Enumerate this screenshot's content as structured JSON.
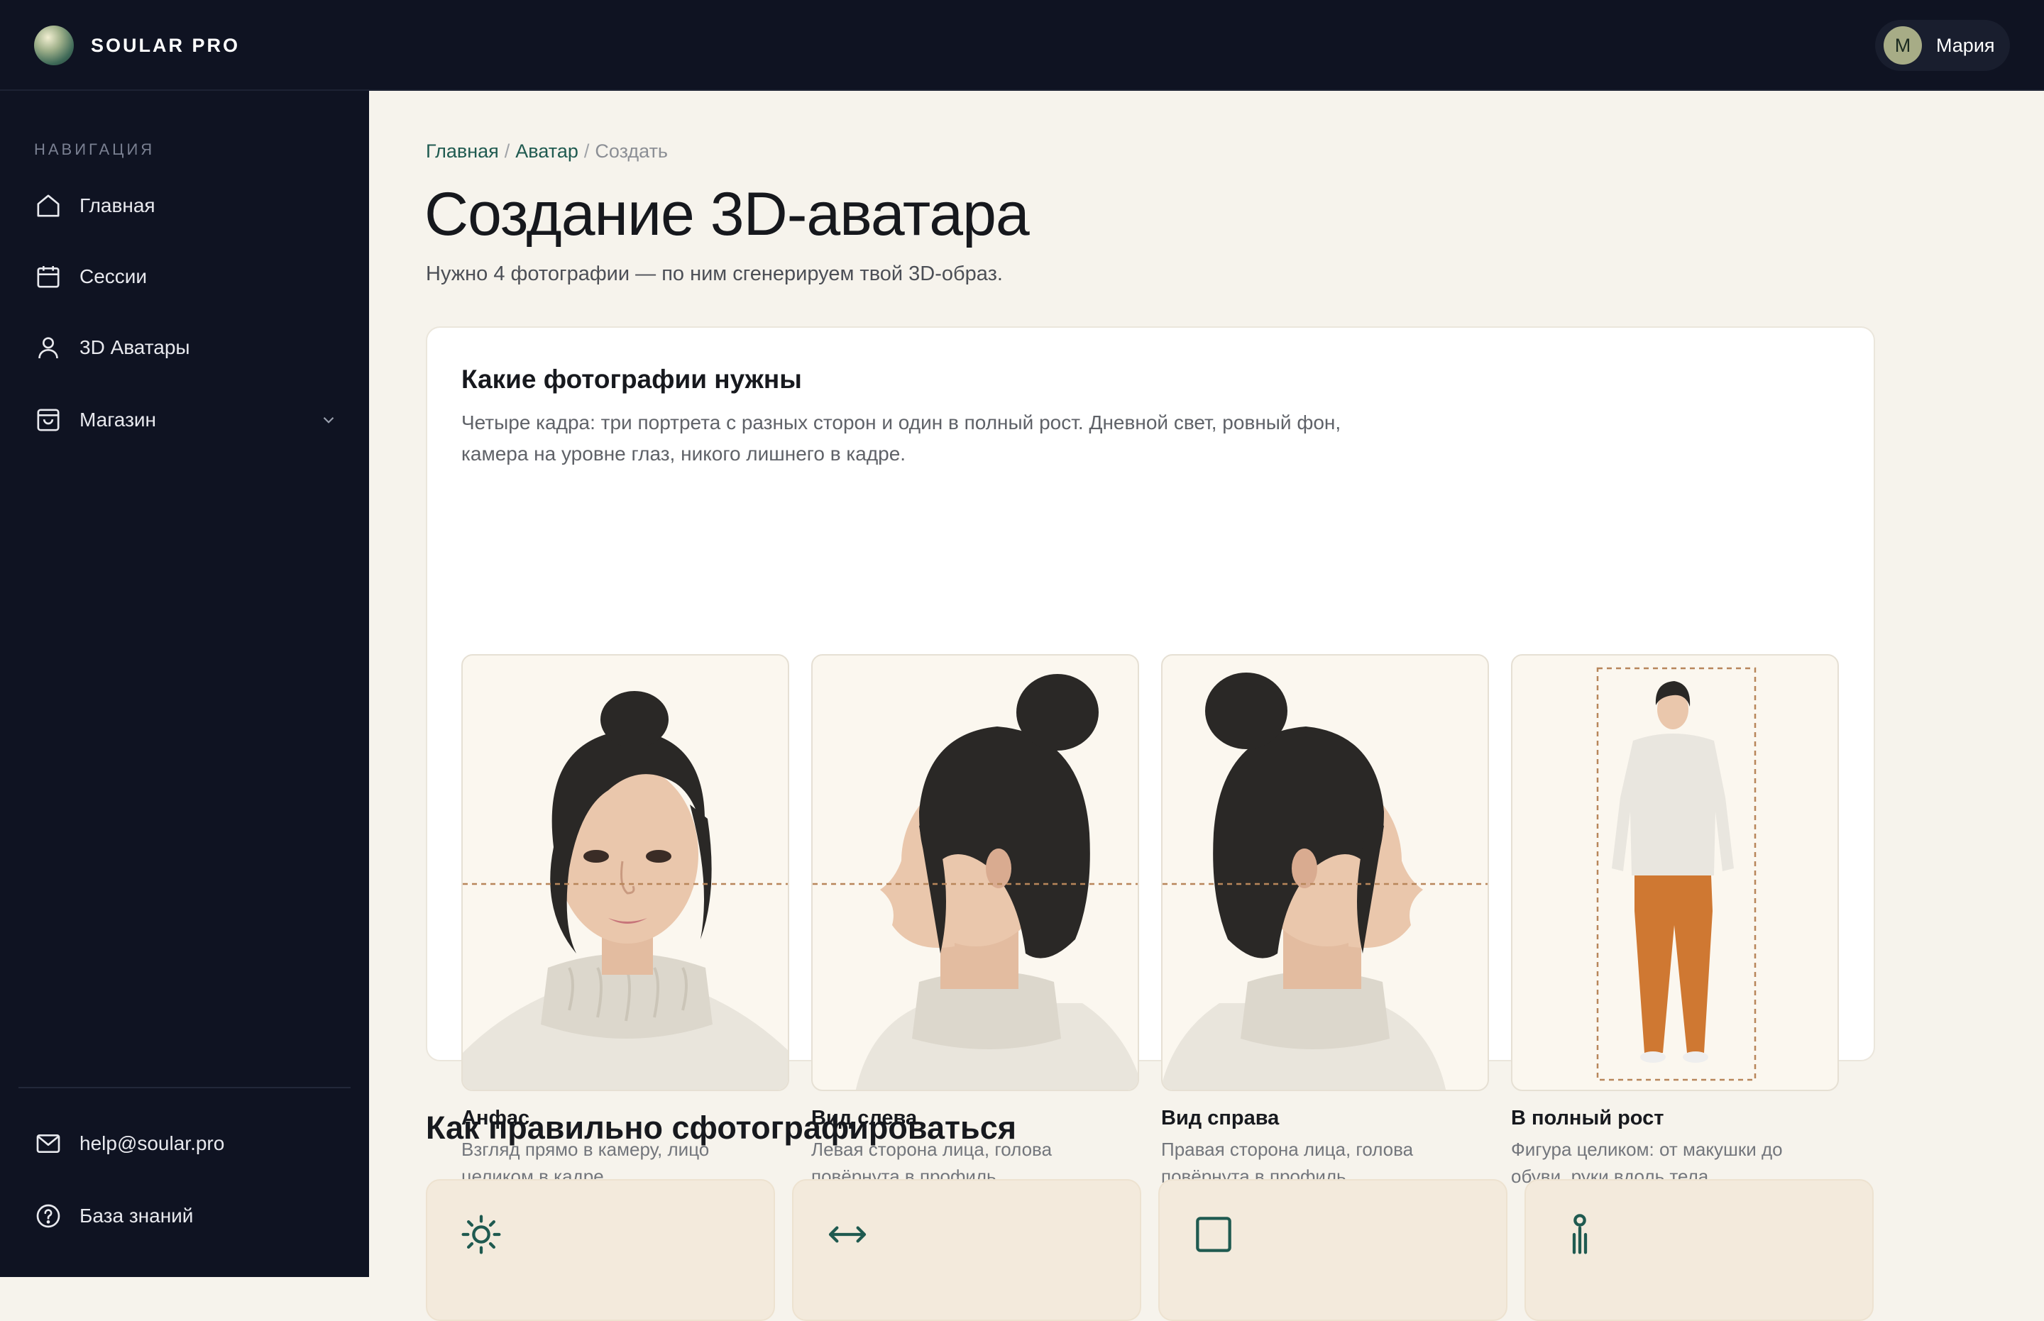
{
  "app": {
    "brand": "SOULAR PRO"
  },
  "user": {
    "initial": "M",
    "name": "Мария"
  },
  "sidebar": {
    "heading": "НАВИГАЦИЯ",
    "items": [
      {
        "label": "Главная",
        "icon": "home-icon"
      },
      {
        "label": "Сессии",
        "icon": "calendar-icon"
      },
      {
        "label": "3D Аватары",
        "icon": "user-icon"
      },
      {
        "label": "Магазин",
        "icon": "shopping-bag-icon"
      }
    ],
    "footer": [
      {
        "label": "help@soular.pro",
        "icon": "mail-icon"
      },
      {
        "label": "База знаний",
        "icon": "help-circle-icon"
      }
    ]
  },
  "breadcrumb": {
    "home": "Главная",
    "avatar": "Аватар",
    "current": "Создать",
    "separator": "/"
  },
  "page": {
    "title": "Создание 3D-аватара",
    "subtitle": "Нужно 4 фотографии — по ним сгенерируем твой 3D-образ."
  },
  "photos_card": {
    "title": "Какие фотографии нужны",
    "description": "Четыре кадра: три портрета с разных сторон и один в полный рост. Дневной свет, ровный фон, камера на уровне глаз, никого лишнего в кадре.",
    "items": [
      {
        "title": "Анфас",
        "description": "Взгляд прямо в камеру, лицо целиком в кадре"
      },
      {
        "title": "Вид слева",
        "description": "Левая сторона лица, голова повёрнута в профиль"
      },
      {
        "title": "Вид справа",
        "description": "Правая сторона лица, голова повёрнута в профиль"
      },
      {
        "title": "В полный рост",
        "description": "Фигура целиком: от макушки до обуви, руки вдоль тела"
      }
    ]
  },
  "tips": {
    "title": "Как правильно сфотографироваться",
    "icons": [
      "sun-icon",
      "arrows-horizontal-icon",
      "square-frame-icon",
      "person-stand-icon"
    ]
  },
  "colors": {
    "sidebar_bg": "#0f1322",
    "content_bg": "#f6f3ec",
    "accent": "#1f5a50",
    "guide_line": "#b8865a",
    "tip_card_bg": "#f3eadc"
  }
}
